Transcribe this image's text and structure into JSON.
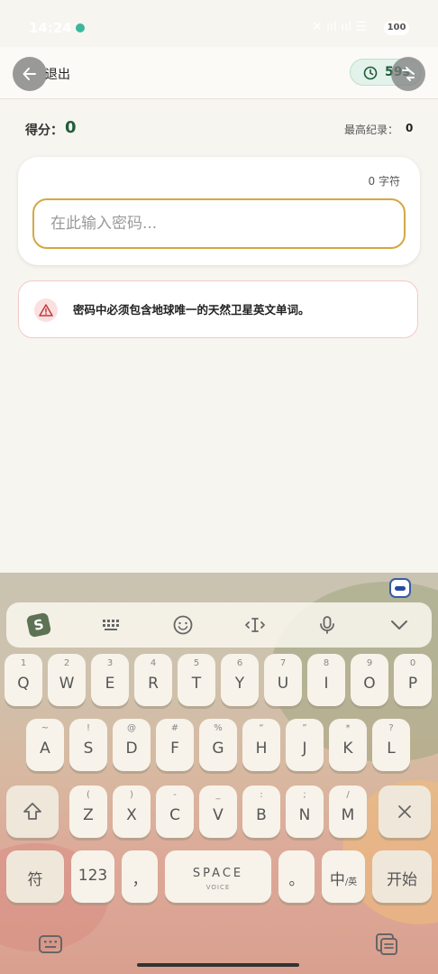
{
  "status_bar": {
    "time": "14:24",
    "battery": "100"
  },
  "header": {
    "exit_label": "退出",
    "timer": "59s"
  },
  "score": {
    "label": "得分：",
    "value": "0",
    "best_label": "最高纪录：",
    "best_value": "0"
  },
  "password_card": {
    "char_count": "0  字符",
    "placeholder": "在此输入密码..."
  },
  "rule": {
    "text": "密码中必须包含地球唯一的天然卫星英文单词。"
  },
  "keyboard": {
    "row1": [
      {
        "hint": "1",
        "key": "Q"
      },
      {
        "hint": "2",
        "key": "W"
      },
      {
        "hint": "3",
        "key": "E"
      },
      {
        "hint": "4",
        "key": "R"
      },
      {
        "hint": "5",
        "key": "T"
      },
      {
        "hint": "6",
        "key": "Y"
      },
      {
        "hint": "7",
        "key": "U"
      },
      {
        "hint": "8",
        "key": "I"
      },
      {
        "hint": "9",
        "key": "O"
      },
      {
        "hint": "0",
        "key": "P"
      }
    ],
    "row2": [
      {
        "hint": "~",
        "key": "A"
      },
      {
        "hint": "!",
        "key": "S"
      },
      {
        "hint": "@",
        "key": "D"
      },
      {
        "hint": "#",
        "key": "F"
      },
      {
        "hint": "%",
        "key": "G"
      },
      {
        "hint": "“",
        "key": "H"
      },
      {
        "hint": "”",
        "key": "J"
      },
      {
        "hint": "*",
        "key": "K"
      },
      {
        "hint": "?",
        "key": "L"
      }
    ],
    "row3": [
      {
        "hint": "(",
        "key": "Z"
      },
      {
        "hint": ")",
        "key": "X"
      },
      {
        "hint": "-",
        "key": "C"
      },
      {
        "hint": "_",
        "key": "V"
      },
      {
        "hint": ":",
        "key": "B"
      },
      {
        "hint": ";",
        "key": "N"
      },
      {
        "hint": "/",
        "key": "M"
      }
    ],
    "symbols_key": "符",
    "numbers_key": "123",
    "comma_key": "，",
    "space_key": "SPACE",
    "space_sub": "VOICE",
    "period_key": "。",
    "lang_key": "中",
    "lang_sub": "/英",
    "enter_key": "开始"
  }
}
